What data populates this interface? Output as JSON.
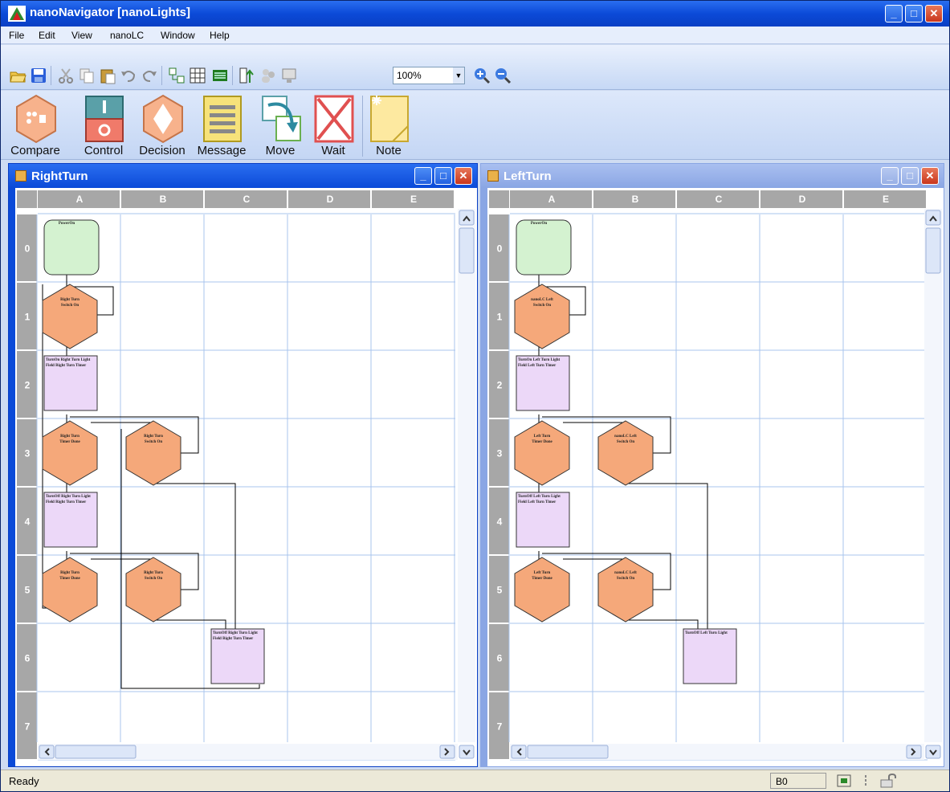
{
  "app": {
    "title": "nanoNavigator [nanoLights]",
    "min_glyph": "_",
    "max_glyph": "□",
    "close_glyph": "✕"
  },
  "menu": [
    "File",
    "Edit",
    "View",
    "nanoLC",
    "Window",
    "Help"
  ],
  "toolbar": {
    "zoom_value": "100%",
    "icons": [
      "open-folder-icon",
      "save-icon",
      "cut-icon",
      "copy-icon",
      "paste-icon",
      "undo-icon",
      "redo-icon",
      "grid-icon",
      "table-icon",
      "list-icon",
      "compile-icon",
      "users-icon",
      "monitor-icon",
      "zoom-in-icon",
      "zoom-out-icon"
    ]
  },
  "palette": {
    "items": [
      "Compare",
      "Control",
      "Decision",
      "Message",
      "Move",
      "Wait",
      "Note"
    ]
  },
  "windows": [
    {
      "name": "RightTurn",
      "active": true,
      "columns": [
        "A",
        "B",
        "C",
        "D",
        "E"
      ],
      "rows": [
        "0",
        "1",
        "2",
        "3",
        "4",
        "5",
        "6",
        "7"
      ],
      "nodes": [
        {
          "type": "start",
          "col": 0,
          "row": 0,
          "label": "PowerOn"
        },
        {
          "type": "decision",
          "col": 0,
          "row": 1,
          "label": "Right Turn Switch On"
        },
        {
          "type": "message",
          "col": 0,
          "row": 2,
          "label": "TurnOn Right Turn Light Field Right Turn Timer"
        },
        {
          "type": "decision",
          "col": 0,
          "row": 3,
          "label": "Right Turn Timer Done"
        },
        {
          "type": "decision",
          "col": 1,
          "row": 3,
          "label": "Right Turn Switch On"
        },
        {
          "type": "message",
          "col": 0,
          "row": 4,
          "label": "TurnOff Right Turn Light Field Right Turn Timer"
        },
        {
          "type": "decision",
          "col": 0,
          "row": 5,
          "label": "Right Turn Timer Done"
        },
        {
          "type": "decision",
          "col": 1,
          "row": 5,
          "label": "Right Turn Switch On"
        },
        {
          "type": "message",
          "col": 2,
          "row": 6,
          "label": "TurnOff Right Turn Light Field Right Turn Timer"
        }
      ]
    },
    {
      "name": "LeftTurn",
      "active": false,
      "columns": [
        "A",
        "B",
        "C",
        "D",
        "E"
      ],
      "rows": [
        "0",
        "1",
        "2",
        "3",
        "4",
        "5",
        "6",
        "7"
      ],
      "nodes": [
        {
          "type": "start",
          "col": 0,
          "row": 0,
          "label": "PowerOn"
        },
        {
          "type": "decision",
          "col": 0,
          "row": 1,
          "label": "nanoLC Left Switch On"
        },
        {
          "type": "message",
          "col": 0,
          "row": 2,
          "label": "TurnOn Left Turn Light Field Left Turn Timer"
        },
        {
          "type": "decision",
          "col": 0,
          "row": 3,
          "label": "Left Turn Timer Done"
        },
        {
          "type": "decision",
          "col": 1,
          "row": 3,
          "label": "nanoLC Left Switch On"
        },
        {
          "type": "message",
          "col": 0,
          "row": 4,
          "label": "TurnOff Left Turn Light Field Left Turn Timer"
        },
        {
          "type": "decision",
          "col": 0,
          "row": 5,
          "label": "Left Turn Timer Done"
        },
        {
          "type": "decision",
          "col": 1,
          "row": 5,
          "label": "nanoLC Left Switch On"
        },
        {
          "type": "message",
          "col": 2,
          "row": 6,
          "label": "TurnOff Left Turn Light"
        }
      ]
    }
  ],
  "status": {
    "text": "Ready",
    "cell": "B0"
  },
  "colors": {
    "title_active": "#0b4ad8",
    "title_inactive": "#8aa6e4",
    "grid_header": "#a7a7a7",
    "grid_line": "#a9c4ee",
    "start_fill": "#d4f2d0",
    "decision_fill": "#f5a87a",
    "message_fill": "#ecd8f8"
  }
}
